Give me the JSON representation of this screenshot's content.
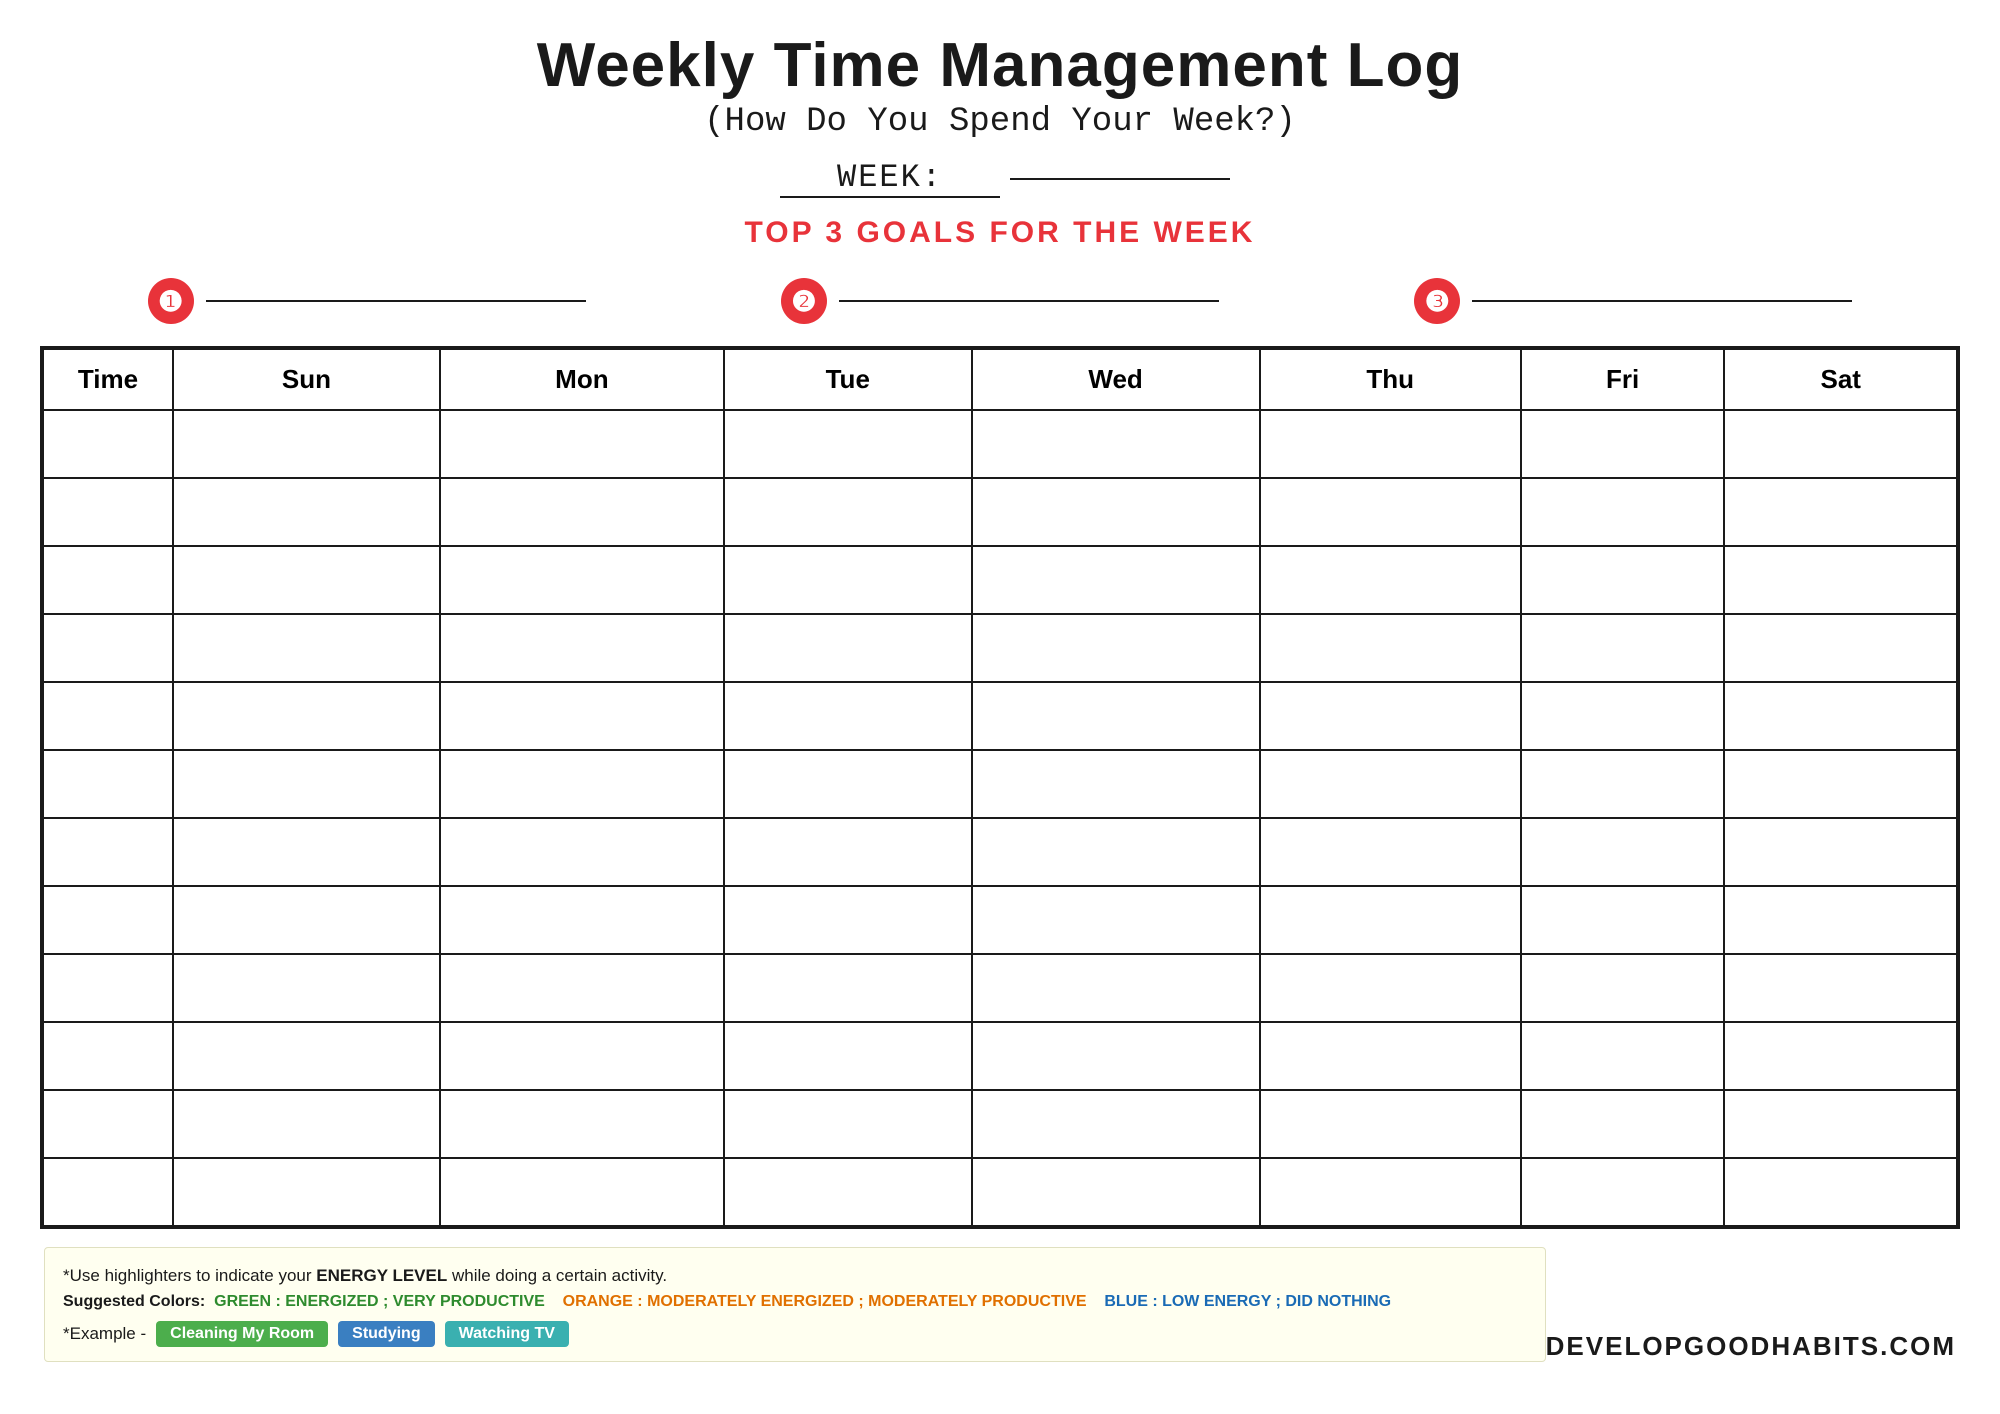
{
  "header": {
    "main_title": "Weekly Time Management Log",
    "subtitle": "(How Do You Spend Your Week?)",
    "week_label": "WEEK:",
    "goals_heading": "TOP 3 GOALS FOR THE WEEK"
  },
  "goals": [
    {
      "number": "❶",
      "index": 1
    },
    {
      "number": "❷",
      "index": 2
    },
    {
      "number": "❸",
      "index": 3
    }
  ],
  "table": {
    "columns": [
      "Time",
      "Sun",
      "Mon",
      "Tue",
      "Wed",
      "Thu",
      "Fri",
      "Sat"
    ],
    "row_count": 12
  },
  "footer": {
    "note_line1": "*Use highlighters to indicate your ENERGY LEVEL while doing a certain activity.",
    "note_line2_prefix": "Suggested Colors:",
    "note_line2_green": "GREEN : ENERGIZED ; VERY PRODUCTIVE",
    "note_line2_orange": "ORANGE : MODERATELY ENERGIZED ; MODERATELY PRODUCTIVE",
    "note_line2_blue": "BLUE : LOW ENERGY ; DID NOTHING",
    "example_label": "*Example -",
    "badge1_label": "Cleaning My Room",
    "badge2_label": "Studying",
    "badge3_label": "Watching TV",
    "brand": "DEVELOPGOODHABITS.COM"
  }
}
